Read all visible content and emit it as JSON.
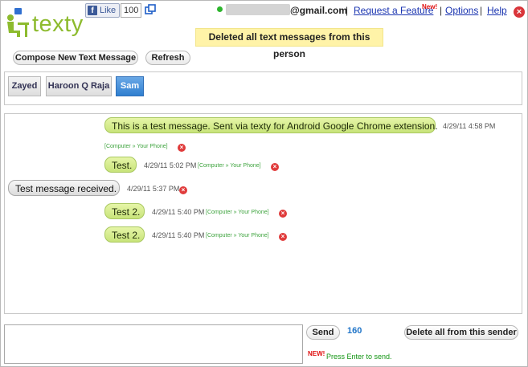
{
  "app": {
    "name": "texty"
  },
  "facebook": {
    "like_label": "Like",
    "like_count": "100"
  },
  "header": {
    "email_domain": "@gmail.com",
    "request_feature": "Request a Feature",
    "new_badge": "New!",
    "options": "Options",
    "help": "Help",
    "separator": "|"
  },
  "status_message": "Deleted all text messages from this person",
  "toolbar": {
    "compose": "Compose New Text Message",
    "refresh": "Refresh"
  },
  "contacts": [
    {
      "name": "Zayed",
      "active": false
    },
    {
      "name": "Haroon Q Raja",
      "active": false
    },
    {
      "name": "Sam",
      "active": true
    }
  ],
  "messages": [
    {
      "direction": "out",
      "text": "This is a test message. Sent via texty for Android Google Chrome extension.",
      "time": "4/29/11 4:58 PM",
      "route": "[Computer » Your Phone]"
    },
    {
      "direction": "out",
      "text": "Test.",
      "time": "4/29/11 5:02 PM",
      "route": "[Computer » Your Phone]"
    },
    {
      "direction": "in",
      "text": "Test message received.",
      "time": "4/29/11 5:37 PM",
      "route": ""
    },
    {
      "direction": "out",
      "text": "Test 2.",
      "time": "4/29/11 5:40 PM",
      "route": "[Computer » Your Phone]"
    },
    {
      "direction": "out",
      "text": "Test 2.",
      "time": "4/29/11 5:40 PM",
      "route": "[Computer » Your Phone]"
    }
  ],
  "composer": {
    "value": "",
    "send": "Send",
    "chars_remaining": "160",
    "delete_all": "Delete all from this sender",
    "new_badge": "NEW!",
    "hint": "Press Enter to send."
  },
  "colors": {
    "brand_green": "#8dbb2e",
    "outgoing_bubble": "#d6ec8e",
    "incoming_bubble": "#e6e6e6",
    "active_tab": "#3d8bd8",
    "status_banner": "#fff3a8",
    "delete_red": "#e03b3b",
    "counter_blue": "#1f74c8"
  },
  "icons": {
    "logo": "person-at-desk-icon",
    "popout": "popout-window-icon",
    "close": "close-icon",
    "delete_message": "delete-x-icon"
  }
}
